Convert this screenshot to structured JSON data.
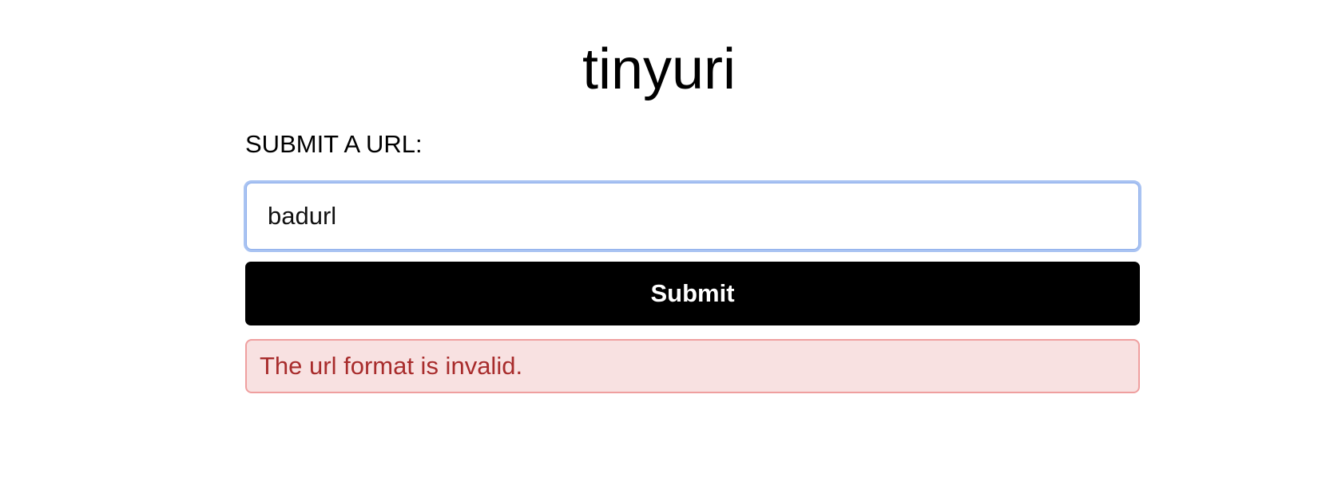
{
  "header": {
    "title": "tinyuri"
  },
  "form": {
    "label": "SUBMIT A URL:",
    "url_input_value": "badurl",
    "submit_label": "Submit"
  },
  "alert": {
    "message": "The url format is invalid."
  },
  "colors": {
    "focus_ring": "#8fb0ec",
    "button_background": "#000000",
    "error_background": "#f8e1e1",
    "error_border": "#ef9f9f",
    "error_text": "#a82c2c"
  }
}
